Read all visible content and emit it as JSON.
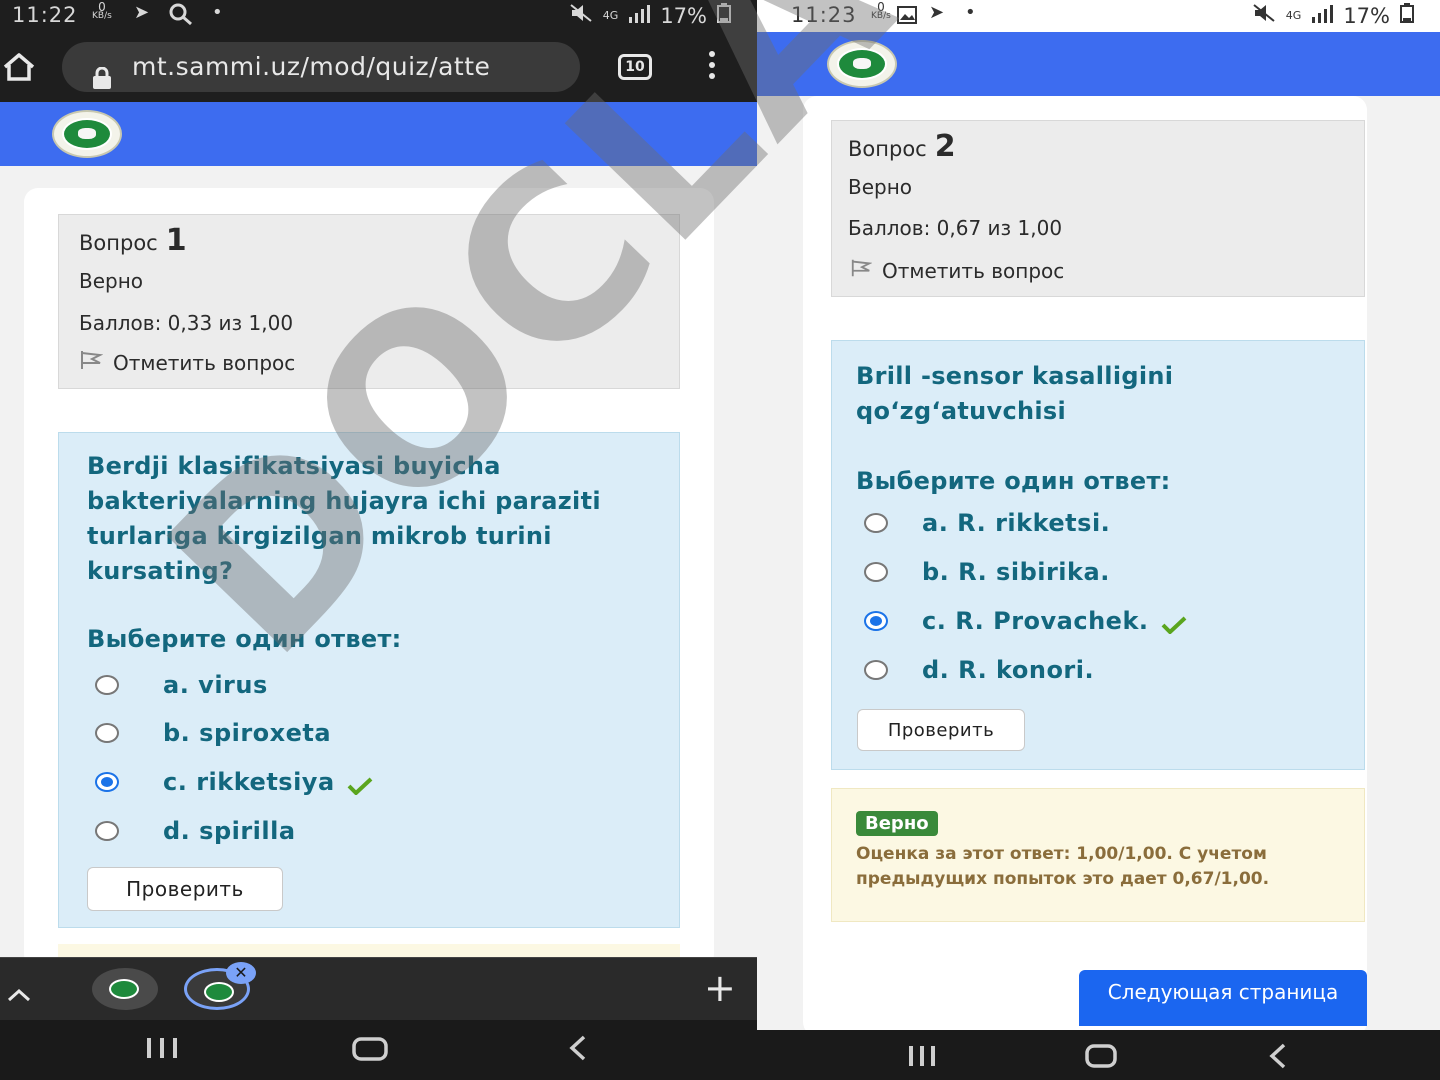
{
  "left": {
    "status": {
      "time": "11:22",
      "kbs_value": "0",
      "kbs_unit": "KB/s",
      "network": "4G",
      "battery": "17%"
    },
    "browser": {
      "url": "mt.sammi.uz/mod/quiz/atte",
      "tab_count": "10"
    },
    "question": {
      "label": "Вопрос",
      "number": "1",
      "state": "Верно",
      "grade": "Баллов: 0,33 из 1,00",
      "flag_label": "Отметить вопрос",
      "text": "Berdji klasifikatsiyasi buyicha bakteriyalarning hujayra ichi paraziti turlariga kirgizilgan mikrob turini kursating?",
      "prompt": "Выберите один ответ:",
      "answers": [
        {
          "label": "a. virus",
          "selected": false
        },
        {
          "label": "b. spiroxeta",
          "selected": false
        },
        {
          "label": "c. rikketsiya",
          "selected": true,
          "correct": true
        },
        {
          "label": "d. spirilla",
          "selected": false
        }
      ],
      "check_label": "Проверить"
    }
  },
  "right": {
    "status": {
      "time": "11:23",
      "kbs_value": "0",
      "kbs_unit": "KB/s",
      "network": "4G",
      "battery": "17%"
    },
    "question": {
      "label": "Вопрос",
      "number": "2",
      "state": "Верно",
      "grade": "Баллов: 0,67 из 1,00",
      "flag_label": "Отметить вопрос",
      "text": "Brill -sensor kasalligini qo‘zg‘atuvchisi",
      "prompt": "Выберите один ответ:",
      "answers": [
        {
          "label": "a. R. rikketsi.",
          "selected": false
        },
        {
          "label": "b. R. sibirika.",
          "selected": false
        },
        {
          "label": "c. R. Provachek.",
          "selected": true,
          "correct": true
        },
        {
          "label": "d. R. konori.",
          "selected": false
        }
      ],
      "check_label": "Проверить",
      "feedback": {
        "badge": "Верно",
        "line1": "Оценка за этот ответ: 1,00/1,00. С учетом",
        "line2": "предыдущих попыток это дает 0,67/1,00."
      },
      "next_label": "Следующая страница"
    }
  },
  "watermark": "DOCLAB.UZ",
  "colors": {
    "header_blue": "#3d6cf0",
    "question_text": "#13677e",
    "correct_green": "#5aa51e",
    "radio_blue": "#1b73e8"
  }
}
